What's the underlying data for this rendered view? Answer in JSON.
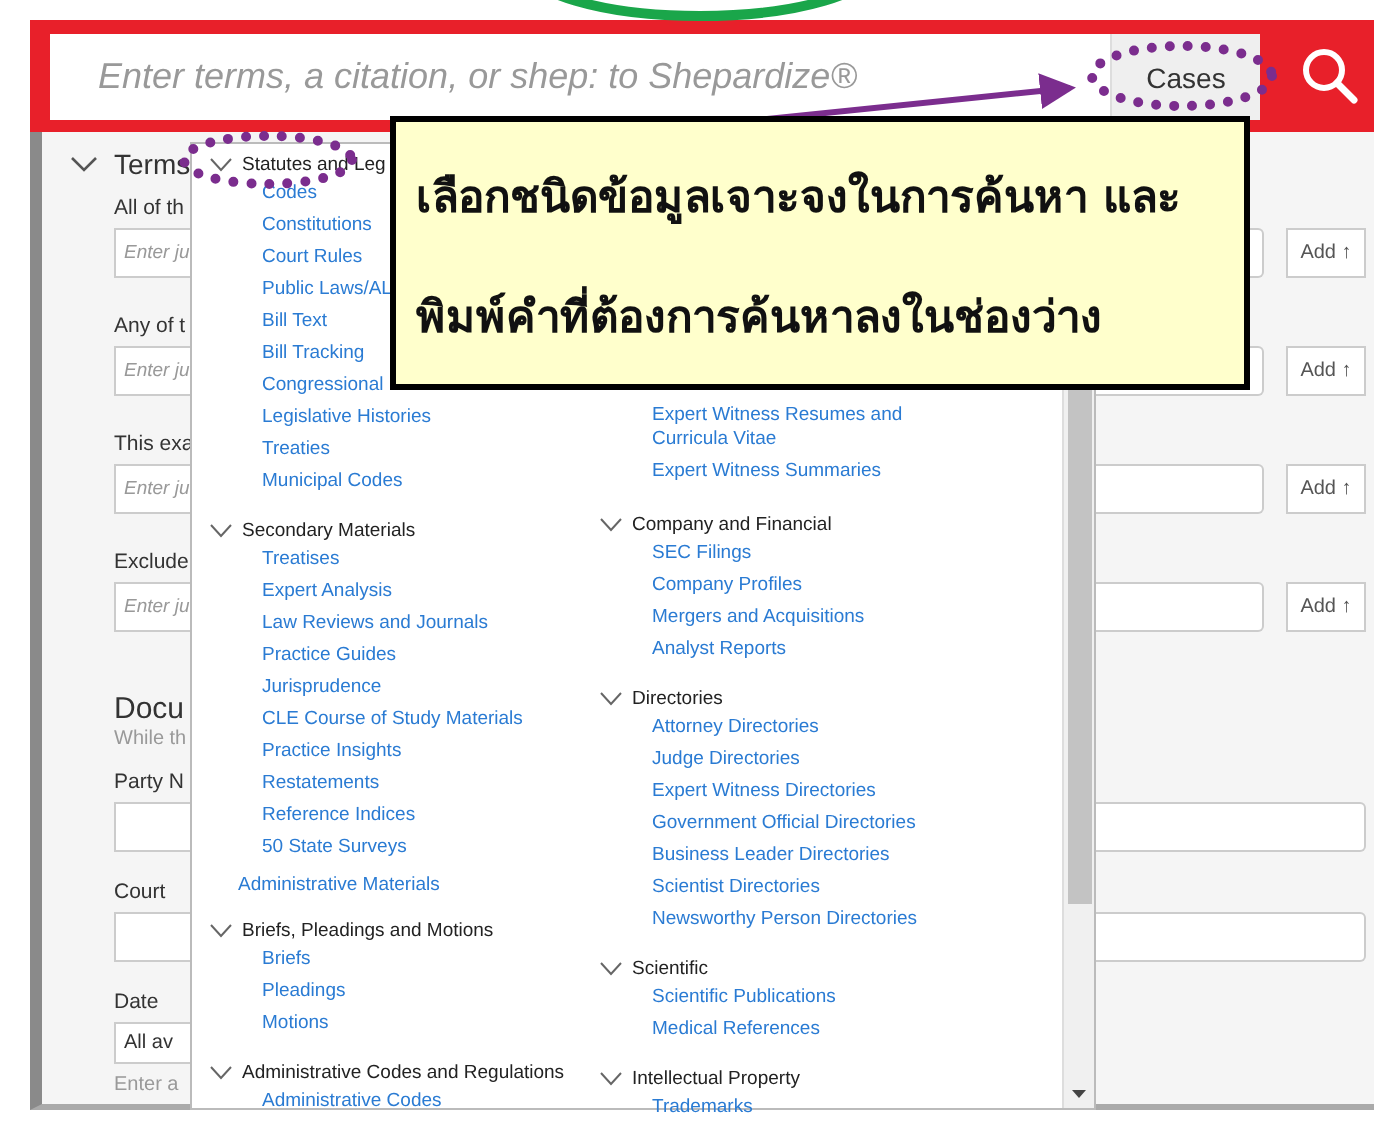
{
  "search_bar": {
    "placeholder": "Enter terms, a citation, or shep: to Shepardize®",
    "content_type": "Cases"
  },
  "form": {
    "terms_heading": "Terms",
    "term_fields": [
      {
        "label": "All of th",
        "placeholder": "Enter ju",
        "add_button": "Add ↑"
      },
      {
        "label": "Any of t",
        "placeholder": "Enter ju",
        "add_button": "Add ↑"
      },
      {
        "label": "This exa",
        "placeholder": "Enter ju",
        "add_button": "Add ↑"
      },
      {
        "label": "Exclude",
        "placeholder": "Enter ju",
        "add_button": "Add ↑"
      }
    ],
    "document_heading": "Docu",
    "document_note": "While th",
    "fields": [
      {
        "label": "Party N"
      },
      {
        "label": "Court"
      }
    ],
    "date": {
      "label": "Date",
      "value": "All av",
      "hint": "Enter a"
    }
  },
  "content_type_menu": {
    "columns": [
      [
        {
          "kind": "group",
          "title": "Statutes and Leg",
          "items": [
            "Codes",
            "Constitutions",
            "Court Rules",
            "Public Laws/AL",
            "Bill Text",
            "Bill Tracking",
            "Congressional",
            "Legislative Histories",
            "Treaties",
            "Municipal Codes"
          ]
        },
        {
          "kind": "group",
          "title": "Secondary Materials",
          "items": [
            "Treatises",
            "Expert Analysis",
            "Law Reviews and Journals",
            "Practice Guides",
            "Jurisprudence",
            "CLE Course of Study Materials",
            "Practice Insights",
            "Restatements",
            "Reference Indices",
            "50 State Surveys"
          ]
        },
        {
          "kind": "link",
          "title": "Administrative Materials"
        },
        {
          "kind": "group",
          "title": "Briefs, Pleadings and Motions",
          "items": [
            "Briefs",
            "Pleadings",
            "Motions"
          ]
        },
        {
          "kind": "group",
          "title": "Administrative Codes and Regulations",
          "items": [
            "Administrative Codes"
          ]
        }
      ],
      [
        {
          "kind": "items",
          "items": [
            "Expert Witness Resumes and Curricula Vitae",
            "Expert Witness Summaries"
          ]
        },
        {
          "kind": "group",
          "title": "Company and Financial",
          "items": [
            "SEC Filings",
            "Company Profiles",
            "Mergers and Acquisitions",
            "Analyst Reports"
          ]
        },
        {
          "kind": "group",
          "title": "Directories",
          "items": [
            "Attorney Directories",
            "Judge Directories",
            "Expert Witness Directories",
            "Government Official Directories",
            "Business Leader Directories",
            "Scientist Directories",
            "Newsworthy Person Directories"
          ]
        },
        {
          "kind": "group",
          "title": "Scientific",
          "items": [
            "Scientific Publications",
            "Medical References"
          ]
        },
        {
          "kind": "group",
          "title": "Intellectual Property",
          "items": [
            "Trademarks"
          ]
        }
      ]
    ]
  },
  "callout": {
    "lines": [
      "เลือกชนิดข้อมูลเจาะจงในการค้นหา และ",
      "พิมพ์คำที่ต้องการค้นหาลงในช่องว่าง"
    ]
  }
}
